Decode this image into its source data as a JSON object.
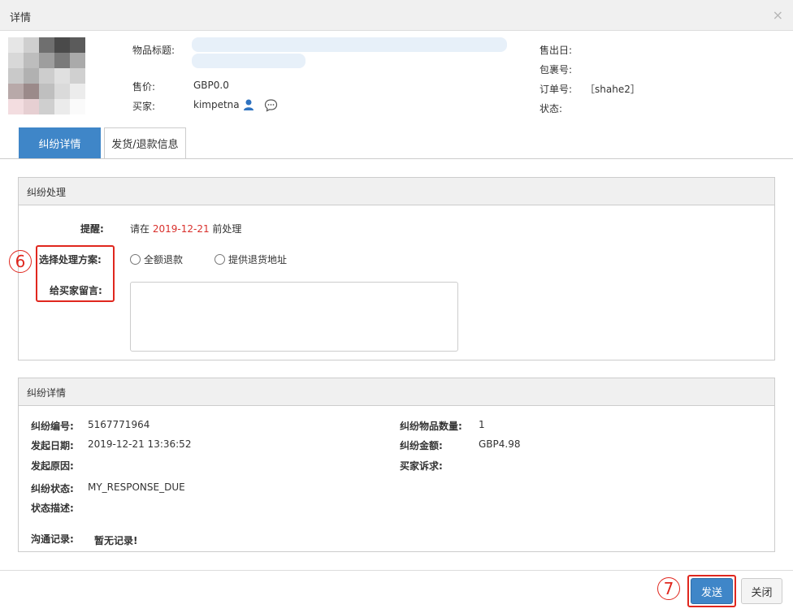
{
  "dialog": {
    "title": "详情",
    "close_glyph": "×"
  },
  "product": {
    "title_label": "物品标题:",
    "price_label": "售价:",
    "price_value": "GBP0.0",
    "buyer_label": "买家:",
    "buyer_value": "kimpetna",
    "sold_date_label": "售出日:",
    "package_label": "包裹号:",
    "order_label": "订单号:",
    "order_value": "［shahe2］",
    "status_label": "状态:"
  },
  "tabs": [
    {
      "label": "纠纷详情",
      "active": true
    },
    {
      "label": "发货/退款信息",
      "active": false
    }
  ],
  "handling": {
    "panel_title": "纠纷处理",
    "reminder_label": "提醒:",
    "reminder_prefix": "请在",
    "reminder_date": "2019-12-21",
    "reminder_suffix": "前处理",
    "plan_label": "选择处理方案:",
    "option_full_refund": "全额退款",
    "option_return_address": "提供退货地址",
    "message_label": "给买家留言:",
    "message_value": ""
  },
  "details": {
    "panel_title": "纠纷详情",
    "id_label": "纠纷编号:",
    "id_value": "5167771964",
    "date_label": "发起日期:",
    "date_value": "2019-12-21 13:36:52",
    "reason_label": "发起原因:",
    "reason_value": "",
    "status_label": "纠纷状态:",
    "status_value": "MY_RESPONSE_DUE",
    "desc_label": "状态描述:",
    "desc_value": "",
    "qty_label": "纠纷物品数量:",
    "qty_value": "1",
    "amount_label": "纠纷金额:",
    "amount_value": "GBP4.98",
    "claim_label": "买家诉求:",
    "claim_value": "",
    "comm_label": "沟通记录:",
    "comm_value": "暂无记录!"
  },
  "annotations": {
    "step6": "6",
    "step7": "7"
  },
  "footer": {
    "send_label": "发送",
    "close_label": "关闭"
  },
  "colors": {
    "accent": "#3f86c8",
    "highlight": "#e0271e",
    "date": "#d9302c"
  },
  "icons": {
    "buyer_badge": "user-badge-icon",
    "chat": "chat-bubble-icon"
  }
}
